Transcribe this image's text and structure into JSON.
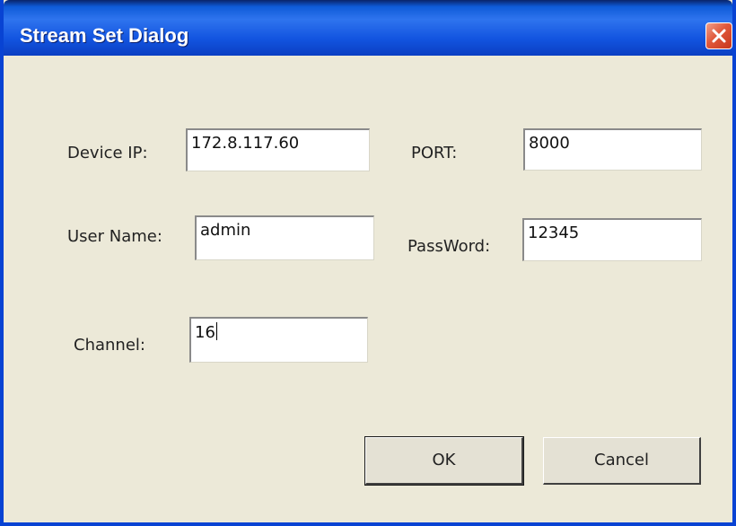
{
  "window": {
    "title": "Stream Set Dialog",
    "close_icon": "close-icon"
  },
  "form": {
    "device_ip": {
      "label": "Device IP:",
      "value": "172.8.117.60"
    },
    "port": {
      "label": "PORT:",
      "value": "8000"
    },
    "user_name": {
      "label": "User Name:",
      "value": "admin"
    },
    "password": {
      "label": "PassWord:",
      "value": "12345"
    },
    "channel": {
      "label": "Channel:",
      "value": "16"
    }
  },
  "buttons": {
    "ok": "OK",
    "cancel": "Cancel"
  },
  "colors": {
    "title_bar": "#0e5bd8",
    "dialog_background": "#ece9d8",
    "close_button": "#e0583a"
  }
}
